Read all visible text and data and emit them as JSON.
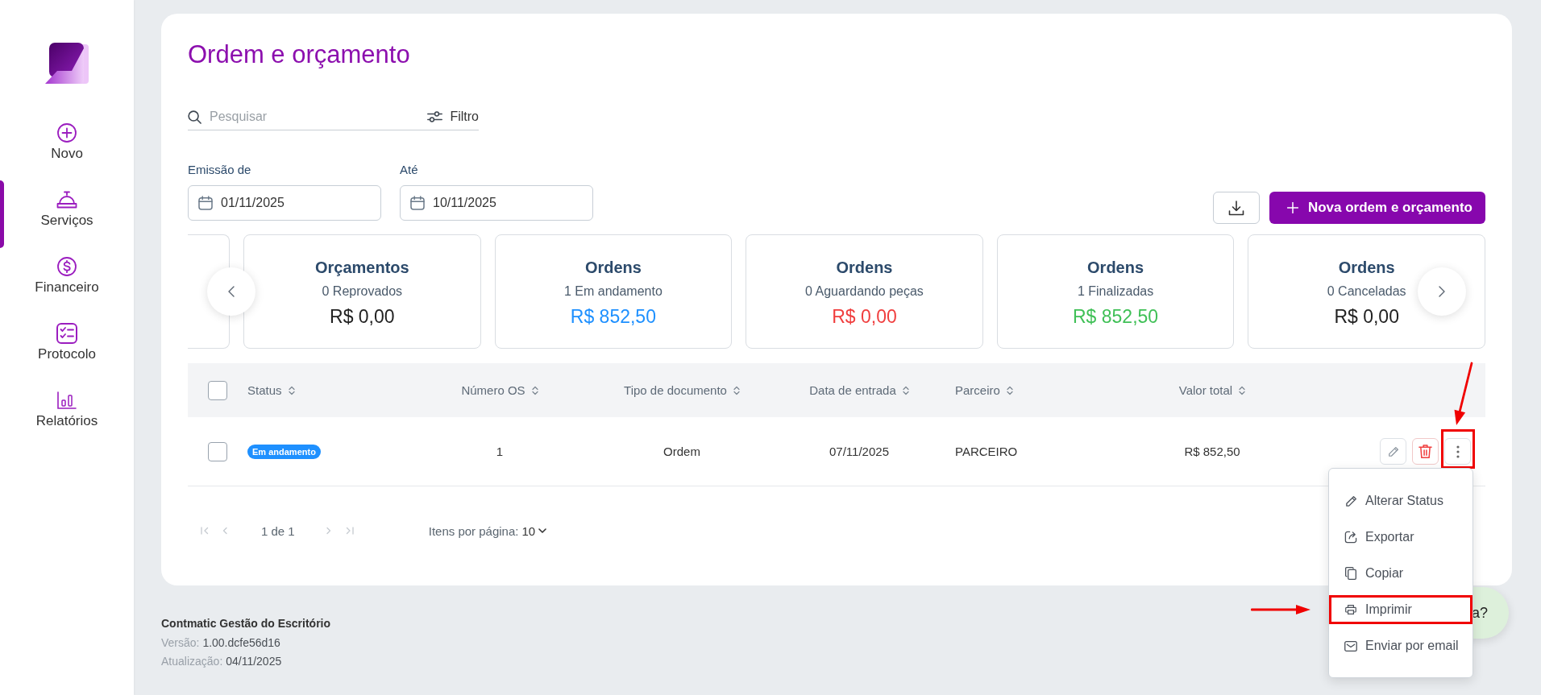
{
  "sidebar": {
    "items": [
      {
        "label": "Novo",
        "selected": false
      },
      {
        "label": "Serviços",
        "selected": true
      },
      {
        "label": "Financeiro",
        "selected": false
      },
      {
        "label": "Protocolo",
        "selected": false
      },
      {
        "label": "Relatórios",
        "selected": false
      }
    ]
  },
  "page": {
    "title": "Ordem e orçamento"
  },
  "search": {
    "placeholder": "Pesquisar",
    "filter_label": "Filtro"
  },
  "date_filters": [
    {
      "label": "Emissão de",
      "value": "01/11/2025"
    },
    {
      "label": "Até",
      "value": "10/11/2025"
    }
  ],
  "new_button": {
    "label": "Nova ordem e orçamento"
  },
  "summary_cards": [
    {
      "title": "Orçamentos",
      "subtitle": "0 Reprovados",
      "value": "R$ 0,00",
      "color": "#222222"
    },
    {
      "title": "Ordens",
      "subtitle": "1 Em andamento",
      "value": "R$ 852,50",
      "color": "#1e90ff"
    },
    {
      "title": "Ordens",
      "subtitle": "0 Aguardando peças",
      "value": "R$ 0,00",
      "color": "#f03e3e"
    },
    {
      "title": "Ordens",
      "subtitle": "1 Finalizadas",
      "value": "R$ 852,50",
      "color": "#40c057"
    },
    {
      "title": "Ordens",
      "subtitle": "0 Canceladas",
      "value": "R$ 0,00",
      "color": "#222222"
    }
  ],
  "table": {
    "all_selected": false,
    "columns": [
      {
        "label": "Status"
      },
      {
        "label": "Número OS"
      },
      {
        "label": "Tipo de documento"
      },
      {
        "label": "Data de entrada"
      },
      {
        "label": "Parceiro"
      },
      {
        "label": "Valor total"
      }
    ],
    "rows": [
      {
        "selected": false,
        "status": "Em andamento",
        "color": "#1e90ff",
        "number": "1",
        "document_type": "Ordem",
        "entry_date": "07/11/2025",
        "partner": "PARCEIRO",
        "total": "R$ 852,50",
        "actions": [
          {
            "kind": "edit",
            "highlighted": false
          },
          {
            "kind": "delete",
            "highlighted": false
          },
          {
            "kind": "more",
            "highlighted": true
          }
        ]
      }
    ]
  },
  "pagination": {
    "buttons": [
      {
        "kind": "first",
        "disabled": true
      },
      {
        "kind": "previous",
        "disabled": true
      },
      {
        "kind": "next",
        "disabled": true
      },
      {
        "kind": "last",
        "disabled": true
      }
    ],
    "page_info": "1 de 1",
    "per_page_label": "Itens por página:",
    "per_page_value": "10"
  },
  "row_menu": {
    "items": [
      {
        "label": "Alterar Status",
        "highlighted": false
      },
      {
        "label": "Exportar",
        "highlighted": false
      },
      {
        "label": "Copiar",
        "highlighted": false
      },
      {
        "label": "Imprimir",
        "highlighted": true
      },
      {
        "label": "Enviar por email",
        "highlighted": false
      }
    ]
  },
  "chat_bubble": {
    "text": "a?"
  },
  "footer": {
    "company": "Contmatic Gestão do Escritório",
    "version_label": "Versão:",
    "version": "1.00.dcfe56d16",
    "update_label": "Atualização:",
    "update": "04/11/2025"
  }
}
